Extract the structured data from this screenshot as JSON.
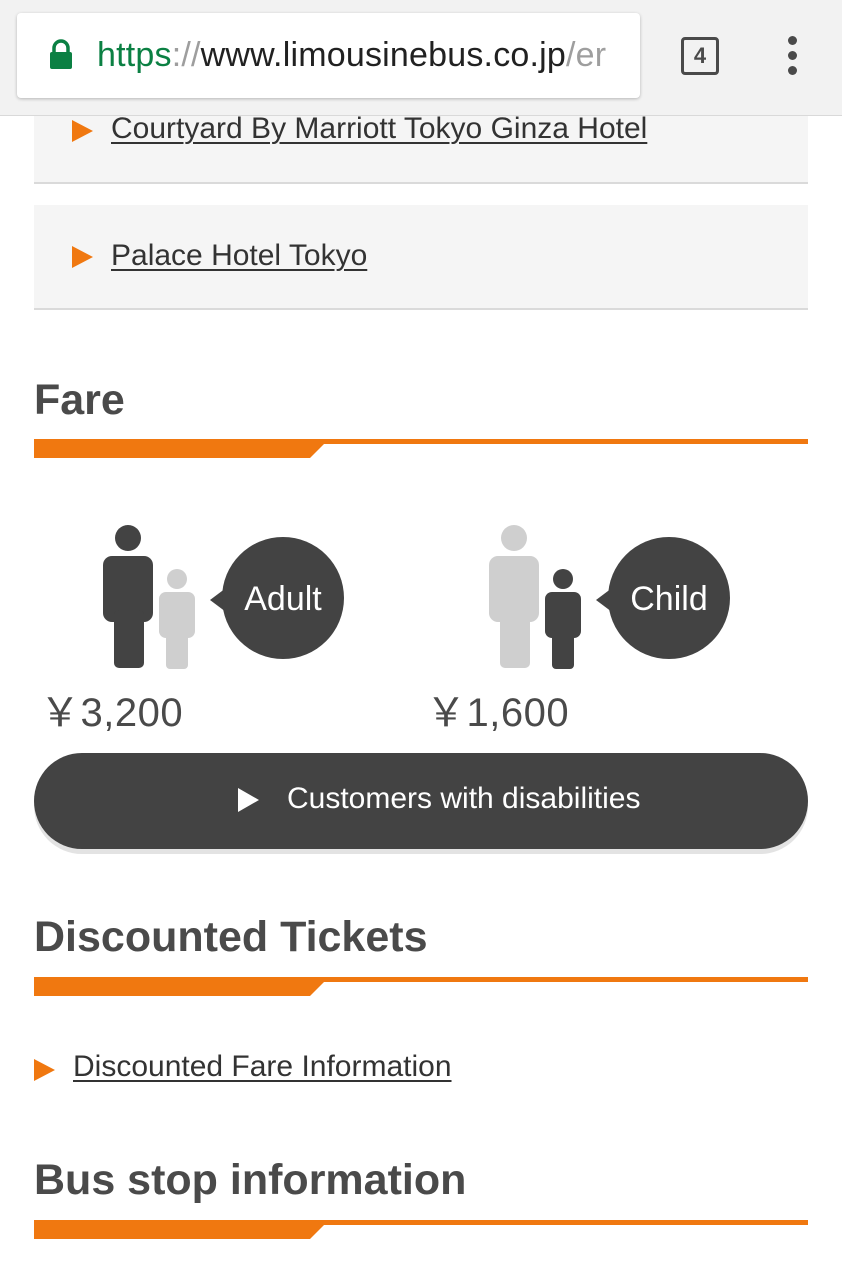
{
  "browser": {
    "url": {
      "scheme": "https",
      "separator": "://",
      "host": "www.limousinebus.co.jp",
      "path": "/er"
    },
    "tab_count": "4",
    "secure_icon": "lock-icon",
    "menu_icon": "more-vertical-icon"
  },
  "hotels": [
    {
      "label": "Courtyard By Marriott Tokyo Ginza Hotel"
    },
    {
      "label": "Palace Hotel Tokyo"
    }
  ],
  "fare": {
    "heading": "Fare",
    "adult": {
      "label": "Adult",
      "price": "￥3,200"
    },
    "child": {
      "label": "Child",
      "price": "￥1,600"
    },
    "disabilities_button": "Customers with disabilities"
  },
  "discounted": {
    "heading": "Discounted Tickets",
    "link": "Discounted Fare Information"
  },
  "bus_stop": {
    "heading": "Bus stop information"
  },
  "colors": {
    "accent": "#f07810",
    "dark": "#434343",
    "secure_green": "#0b8043"
  }
}
